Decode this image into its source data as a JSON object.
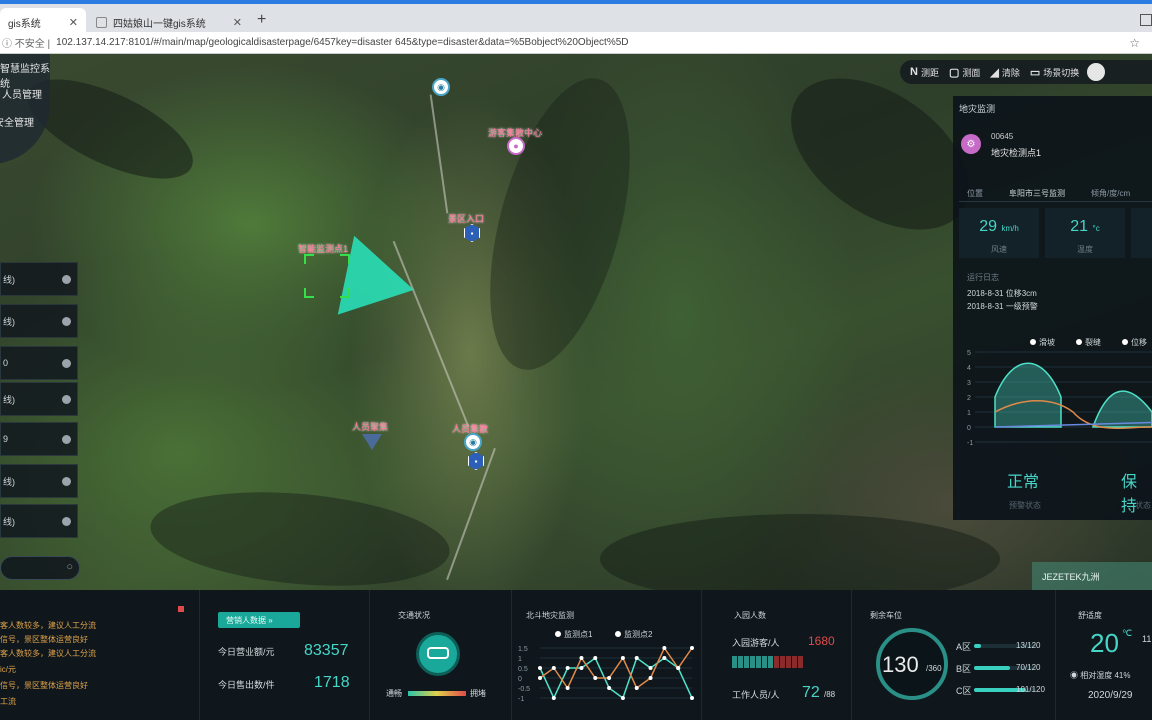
{
  "browser": {
    "tabs": [
      {
        "label": "gis系统",
        "active": true
      },
      {
        "label": "四姑娘山一键gis系统",
        "active": false
      }
    ],
    "security": "不安全",
    "url": "102.137.14.217:8101/#/main/map/geologicaldisasterpage/6457key=disaster 645&type=disaster&data=%5Bobject%20Object%5D"
  },
  "left_menu": {
    "items": [
      "智慧监控系统",
      "人员管理",
      "安全管理"
    ]
  },
  "left_panel": {
    "items": [
      "线)",
      "线)",
      "0",
      "线)",
      "9",
      "线)",
      "线)"
    ]
  },
  "map": {
    "labels": [
      "智能监测点1",
      "游客集散中心",
      "景区入口",
      "人员聚集",
      "人员集散"
    ],
    "marker_icons": [
      "eye-icon",
      "pin-icon",
      "shield-icon",
      "camera-icon"
    ]
  },
  "toolbar": {
    "items": [
      {
        "icon": "measure-icon",
        "label": "测距"
      },
      {
        "icon": "area-icon",
        "label": "测面"
      },
      {
        "icon": "clear-icon",
        "label": "清除"
      },
      {
        "icon": "switch-icon",
        "label": "场景切换"
      }
    ]
  },
  "right_panel": {
    "title": "地灾监测",
    "id": "00645",
    "name": "地灾检测点1",
    "tabs": [
      "位置",
      "阜阳市三号监测",
      "倾角/度/cm"
    ],
    "metrics": [
      {
        "value": "29",
        "unit": "km/h",
        "label": "风速"
      },
      {
        "value": "21",
        "unit": "°c",
        "label": "温度"
      }
    ],
    "log_title": "运行日志",
    "logs": [
      "2018-8-31 位移3cm",
      "2018-8-31 一级预警"
    ],
    "status_left": {
      "value": "正常",
      "label": "预警状态"
    },
    "status_right": {
      "value": "保持",
      "label": "状态"
    },
    "chart_data": {
      "type": "area",
      "series": [
        {
          "name": "滑坡",
          "color": "#4ee0c8"
        },
        {
          "name": "裂缝",
          "color": "#e08a4a"
        },
        {
          "name": "位移",
          "color": "#6a8ae0"
        }
      ],
      "yticks": [
        "5",
        "4",
        "3",
        "2",
        "1",
        "0",
        "-1"
      ],
      "ylim": [
        -1,
        5
      ]
    }
  },
  "brand": {
    "label": "JEZETEK九洲"
  },
  "bottom": {
    "alerts": [
      "客人数较多，建议人工分流",
      "信号，景区整体运营良好",
      "客人数较多，建议人工分流",
      "ic/元",
      "信号，景区整体运营良好",
      "工流"
    ],
    "business": {
      "button": "营销人数据",
      "rows": [
        {
          "label": "今日营业额/元",
          "value": "83357"
        },
        {
          "label": "今日售出数/件",
          "value": "1718"
        }
      ]
    },
    "traffic": {
      "title": "交通状况",
      "smooth": "通畅",
      "jam": "拥堵"
    },
    "monitor": {
      "title": "北斗地灾监测",
      "chart_data": {
        "type": "line",
        "series": [
          {
            "name": "监测点1",
            "color": "#4ee0c8",
            "values": [
              0.5,
              -1,
              0.5,
              0.5,
              1,
              -0.5,
              -1,
              1,
              0.5,
              1,
              0.5,
              -1
            ]
          },
          {
            "name": "监测点2",
            "color": "#e08a4a",
            "values": [
              0,
              0.5,
              -0.5,
              1,
              0,
              0,
              1,
              -0.5,
              0,
              1.5,
              0.5,
              1.5
            ]
          }
        ],
        "yticks": [
          "1.5",
          "1",
          "0.5",
          "0",
          "-0.5",
          "-1"
        ],
        "ylim": [
          -1,
          1.5
        ]
      }
    },
    "visitors": {
      "title": "入园人数",
      "rows": [
        {
          "label": "入园游客/人",
          "value": "1680"
        },
        {
          "label": "工作人员/人",
          "value": "72",
          "sub": "/88"
        }
      ]
    },
    "parking": {
      "title": "剩余车位",
      "total": "130",
      "capacity": "/360",
      "zones": [
        {
          "name": "A区",
          "value": "13/120",
          "fill": 0.11
        },
        {
          "name": "B区",
          "value": "70/120",
          "fill": 0.58
        },
        {
          "name": "C区",
          "value": "101/120",
          "fill": 0.84
        }
      ]
    },
    "weather": {
      "title": "舒适度",
      "temp": "20",
      "unit": "℃",
      "extra": "11",
      "humidity": "相对湿度 41%",
      "date": "2020/9/29"
    }
  }
}
